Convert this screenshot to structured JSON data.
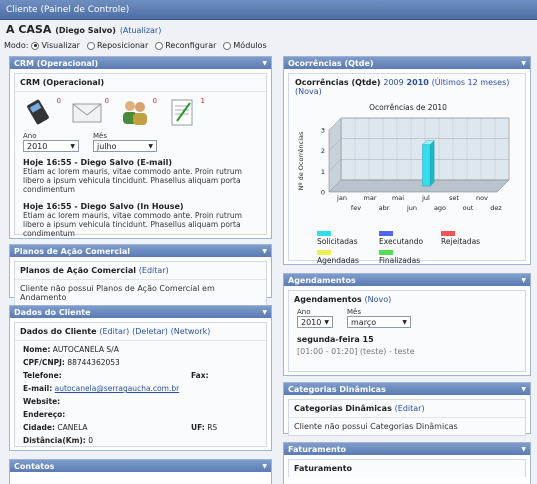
{
  "window_title": "Cliente (Painel de Controle)",
  "client": {
    "name": "A CASA",
    "owner": "(Diego Salvo)",
    "update_link": "(Atualizar)"
  },
  "mode": {
    "label": "Modo:",
    "options": [
      "Visualizar",
      "Reposicionar",
      "Reconfigurar",
      "Módulos"
    ],
    "selected": "Visualizar"
  },
  "crm": {
    "panel_title": "CRM (Operacional)",
    "inner_title": "CRM (Operacional)",
    "counts": {
      "phone": "0",
      "mail": "0",
      "users": "0",
      "notes": "1"
    },
    "year_label": "Ano",
    "year": "2010",
    "month_label": "Mês",
    "month": "julho",
    "entries": [
      {
        "title": "Hoje 16:55 - Diego Salvo (E-mail)",
        "body": "Etiam ac lorem mauris, vitae commodo ante. Proin rutrum libero a ipsum vehicula tincidunt. Phasellus aliquam porta condimentum"
      },
      {
        "title": "Hoje 16:55 - Diego Salvo (In House)",
        "body": "Etiam ac lorem mauris, vitae commodo ante. Proin rutrum libero a ipsum vehicula tincidunt. Phasellus aliquam porta condimentum"
      }
    ]
  },
  "planos": {
    "panel_title": "Planos de Ação Comercial",
    "inner_title": "Planos de Ação Comercial",
    "edit": "(Editar)",
    "note": "Cliente não possui Planos de Ação Comercial em Andamento"
  },
  "dados": {
    "panel_title": "Dados do Cliente",
    "inner_title": "Dados do Cliente",
    "edit": "(Editar)",
    "delete": "(Deletar)",
    "network": "(Network)",
    "nome_label": "Nome:",
    "nome": "AUTOCANELA S/A",
    "cpf_label": "CPF/CNPJ:",
    "cpf": "88744362053",
    "telefone_label": "Telefone:",
    "fax_label": "Fax:",
    "email_label": "E-mail:",
    "email": "autocanela@serragaucha.com.br",
    "website_label": "Website:",
    "endereco_label": "Endereço:",
    "cidade_label": "Cidade:",
    "cidade": "CANELA",
    "uf_label": "UF:",
    "uf": "RS",
    "distancia_label": "Distância(Km):",
    "distancia": "0"
  },
  "contatos": {
    "panel_title": "Contatos"
  },
  "ocorrencias": {
    "panel_title": "Ocorrências (Qtde)",
    "inner_title": "Ocorrências (Qtde)",
    "year_a": "2009",
    "year_b": "2010",
    "last12": "(Últimos 12 meses)",
    "nova": "(Nova)"
  },
  "chart_data": {
    "type": "bar",
    "title": "Ocorrências de 2010",
    "ylabel": "Nº de Ocorrências",
    "xlabel": "",
    "categories": [
      "jan",
      "fev",
      "mar",
      "abr",
      "mai",
      "jun",
      "jul",
      "ago",
      "set",
      "out",
      "nov",
      "dez"
    ],
    "series": [
      {
        "name": "Solicitadas",
        "color": "#33ddee",
        "values": [
          0,
          0,
          0,
          0,
          0,
          0,
          2,
          0,
          0,
          0,
          0,
          0
        ]
      },
      {
        "name": "Executando",
        "color": "#5566ee",
        "values": [
          0,
          0,
          0,
          0,
          0,
          0,
          0,
          0,
          0,
          0,
          0,
          0
        ]
      },
      {
        "name": "Rejeitadas",
        "color": "#ee5555",
        "values": [
          0,
          0,
          0,
          0,
          0,
          0,
          0,
          0,
          0,
          0,
          0,
          0
        ]
      },
      {
        "name": "Agendadas",
        "color": "#eeee55",
        "values": [
          0,
          0,
          0,
          0,
          0,
          0,
          0,
          0,
          0,
          0,
          0,
          0
        ]
      },
      {
        "name": "Finalizadas",
        "color": "#55dd55",
        "values": [
          0,
          0,
          0,
          0,
          0,
          0,
          0,
          0,
          0,
          0,
          0,
          0
        ]
      }
    ],
    "ylim": [
      0,
      3
    ],
    "yticks": [
      "0",
      "1",
      "2",
      "3"
    ],
    "grid": true,
    "legend_position": "bottom"
  },
  "agendamentos": {
    "panel_title": "Agendamentos",
    "inner_title": "Agendamentos",
    "nova": "(Novo)",
    "year_label": "Ano",
    "year": "2010",
    "month_label": "Mês",
    "month": "março",
    "day": "segunda-feira 15",
    "event": "[01:00 - 01:20] (teste) - teste"
  },
  "categorias": {
    "panel_title": "Categorias Dinâmicas",
    "inner_title": "Categorias Dinâmicas",
    "edit": "(Editar)",
    "note": "Cliente não possui Categorias Dinâmicas"
  },
  "faturamento": {
    "panel_title": "Faturamento",
    "inner_title": "Faturamento"
  }
}
